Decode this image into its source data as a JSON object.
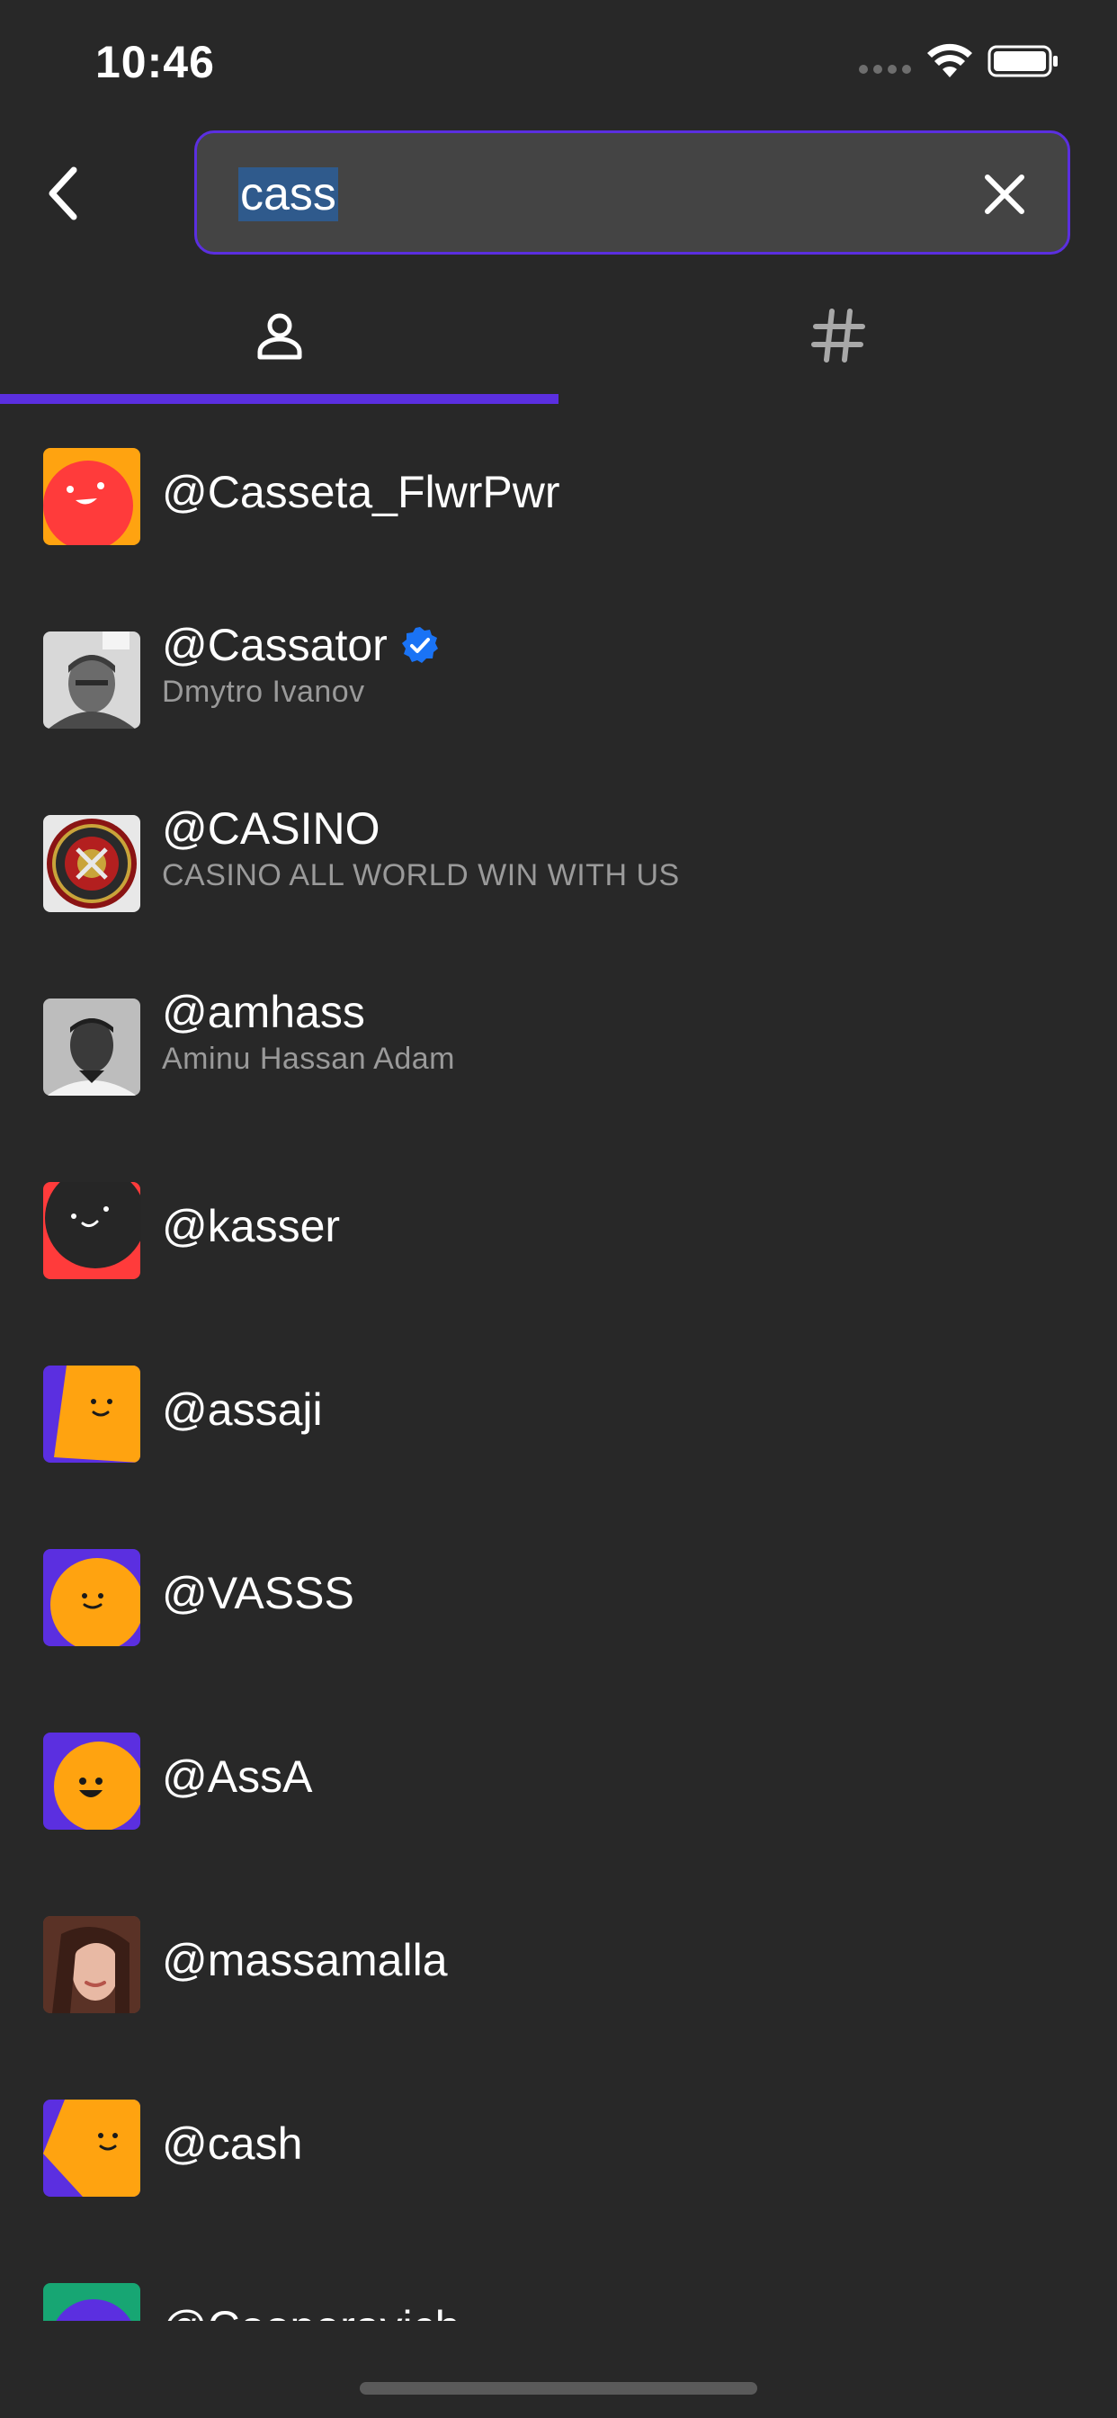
{
  "status_bar": {
    "time": "10:46"
  },
  "search": {
    "value": "cass",
    "back_icon": "chevron-left-icon",
    "clear_icon": "close-icon",
    "border_color": "#5b2fe0"
  },
  "tabs": [
    {
      "name": "people",
      "icon": "person-icon",
      "active": true
    },
    {
      "name": "hashtags",
      "icon": "hashtag-icon",
      "active": false
    }
  ],
  "accent_color": "#5b2fe0",
  "results": [
    {
      "username": "@Casseta_FlwrPwr",
      "display_name": "",
      "verified": false,
      "avatar": "red-face-on-orange"
    },
    {
      "username": "@Cassator",
      "display_name": "Dmytro Ivanov",
      "verified": true,
      "avatar": "photo-man"
    },
    {
      "username": "@CASINO",
      "display_name": "CASINO ALL WORLD WIN WITH US",
      "verified": false,
      "avatar": "roulette"
    },
    {
      "username": "@amhass",
      "display_name": "Aminu Hassan Adam",
      "verified": false,
      "avatar": "photo-man-bw"
    },
    {
      "username": "@kasser",
      "display_name": "",
      "verified": false,
      "avatar": "dark-face-on-red"
    },
    {
      "username": "@assaji",
      "display_name": "",
      "verified": false,
      "avatar": "orange-face-on-purple"
    },
    {
      "username": "@VASSS",
      "display_name": "",
      "verified": false,
      "avatar": "orange-circle-on-purple"
    },
    {
      "username": "@AssA",
      "display_name": "",
      "verified": false,
      "avatar": "orange-circle-smile-on-purple"
    },
    {
      "username": "@massamalla",
      "display_name": "",
      "verified": false,
      "avatar": "photo-woman"
    },
    {
      "username": "@cash",
      "display_name": "",
      "verified": false,
      "avatar": "orange-shape-on-purple"
    },
    {
      "username": "@Cooperavich",
      "display_name": "",
      "verified": false,
      "avatar": "purple-circle-on-green"
    }
  ]
}
